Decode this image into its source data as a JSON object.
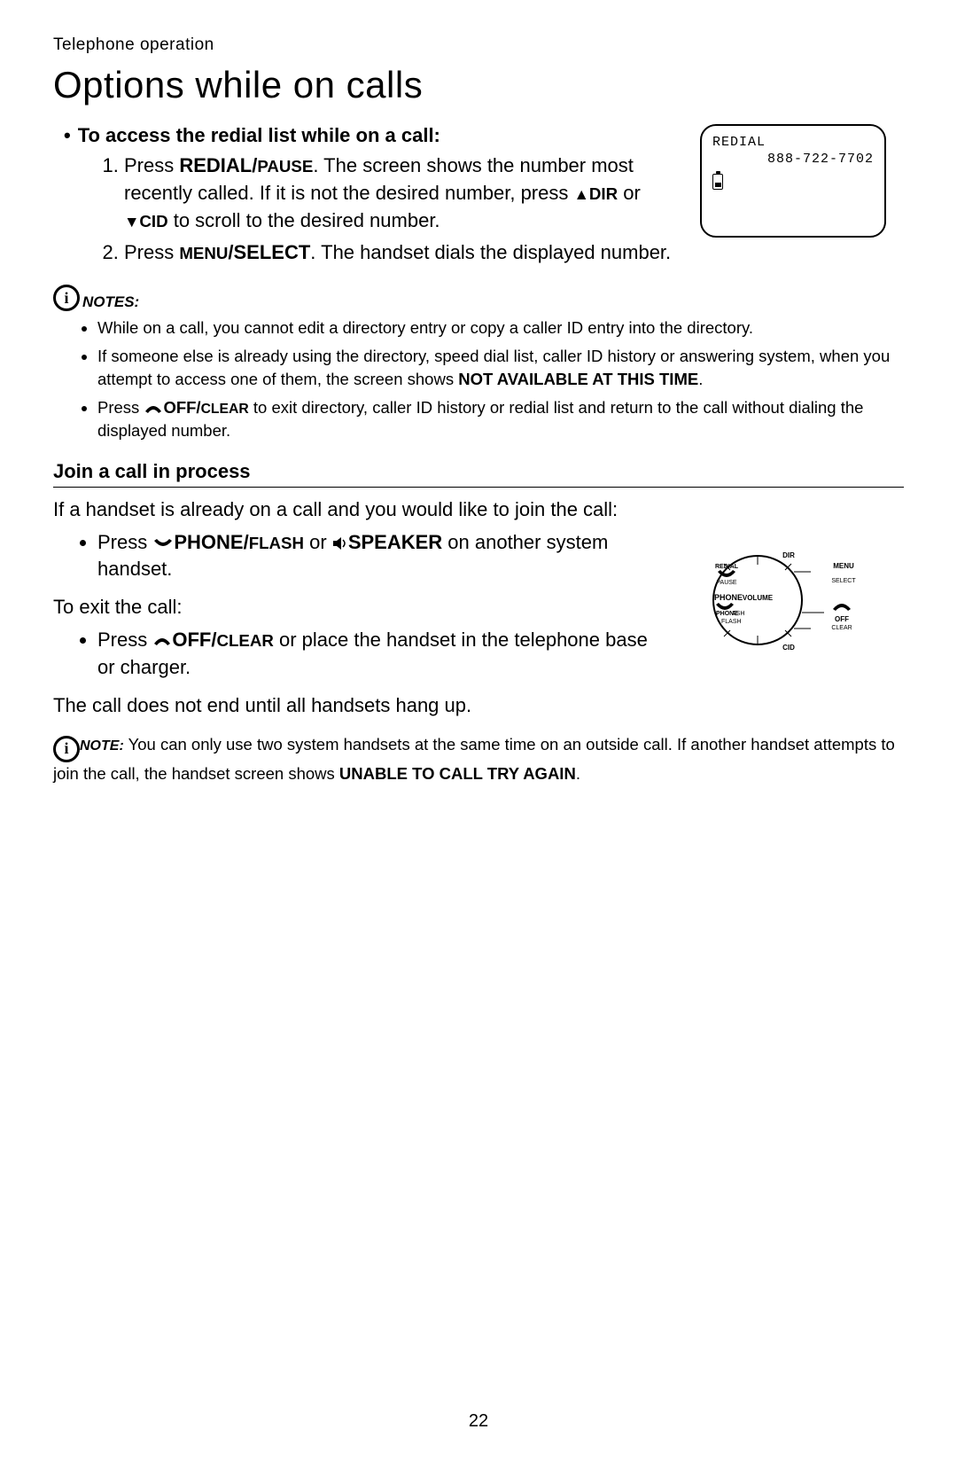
{
  "header": "Telephone operation",
  "title": "Options while on calls",
  "section1_heading": "To access the redial list while on a call:",
  "step1_pre": "Press ",
  "step1_key": "REDIAL/",
  "step1_key2": "PAUSE",
  "step1_rest": ". The screen shows the number most recently called. If it is not the desired number, press ",
  "step1_dir": "DIR",
  "step1_or": " or ",
  "step1_cid": "CID",
  "step1_end": " to scroll to the desired number.",
  "step2_pre": "Press ",
  "step2_key1": "MENU",
  "step2_key2": "/SELECT",
  "step2_rest": ". The handset dials the displayed number.",
  "notes_label": "NOTES:",
  "note1": "While on a call, you cannot edit a directory entry or copy a caller ID entry into the directory.",
  "note2_pre": "If someone else is already using the directory, speed dial list, caller ID history or answering system, when you attempt to access one of them, the screen shows ",
  "note2_bold": "NOT AVAILABLE AT THIS TIME",
  "note2_end": ".",
  "note3_pre": "Press ",
  "note3_key1": "OFF/",
  "note3_key2": "CLEAR",
  "note3_rest": " to exit directory, caller ID history or redial list and return to the call without dialing the displayed number.",
  "subheading": "Join a call in process",
  "join_intro": "If a handset is already on a call and you would like to join the call:",
  "join_step_pre": "Press ",
  "join_phone": "PHONE/",
  "join_flash": "FLASH",
  "join_or": " or ",
  "join_speaker": "SPEAKER",
  "join_end": " on another system handset.",
  "exit_heading": "To exit the call:",
  "exit_step_pre": "Press ",
  "exit_off": "OFF/",
  "exit_clear": "CLEAR",
  "exit_end": " or place the handset in the telephone base or charger.",
  "call_end_note": "The call does not end until all handsets hang up.",
  "final_note_label": "NOTE:",
  "final_note_pre": " You can only use two system handsets at the same time on an outside call. If another handset attempts to join the call, the handset screen shows ",
  "final_note_bold": "UNABLE TO CALL TRY AGAIN",
  "final_note_end": ".",
  "screen": {
    "line1": "REDIAL",
    "line2": "888-722-7702"
  },
  "diagram": {
    "phone": "PHONE",
    "flash": "FLASH",
    "phone2": "PHONE",
    "ash": "ASH",
    "redial": "REDIAL",
    "pause": "PAUSE",
    "dir": "DIR",
    "menu": "MENU",
    "select": "SELECT",
    "off": "OFF",
    "clear": "CLEAR",
    "cid": "CID",
    "volume": "VOLUME"
  },
  "page_number": "22"
}
